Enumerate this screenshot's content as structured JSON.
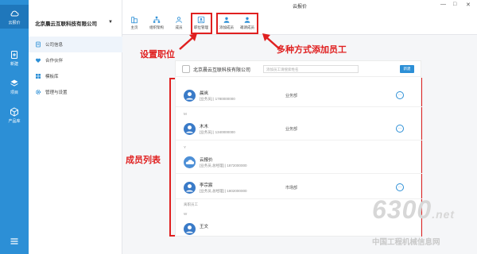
{
  "window": {
    "title": "云报价",
    "minimize": "—",
    "maximize": "□",
    "close": "✕"
  },
  "leftnav": {
    "logo_label": "云报价",
    "items": [
      {
        "label": "新建",
        "icon": "plus-doc-icon"
      },
      {
        "label": "项目",
        "icon": "layers-icon"
      },
      {
        "label": "产品库",
        "icon": "box-icon"
      }
    ],
    "menu_icon": "hamburger-icon"
  },
  "panel": {
    "company_name": "北京晨云互联科技有限公司",
    "caret": "▼",
    "menu": [
      {
        "label": "公司信息",
        "icon": "doc-icon",
        "active": true
      },
      {
        "label": "合作伙伴",
        "icon": "heart-icon",
        "active": false
      },
      {
        "label": "模板库",
        "icon": "grid-icon",
        "active": false
      },
      {
        "label": "管理与设置",
        "icon": "gear-icon",
        "active": false
      }
    ]
  },
  "toolbar": {
    "buttons": [
      {
        "label": "主页",
        "icon": "building-icon"
      },
      {
        "label": "组织架构",
        "icon": "org-icon"
      },
      {
        "label": "成员",
        "icon": "person-icon"
      },
      {
        "label": "职位管理",
        "icon": "position-icon"
      },
      {
        "label": "添加成员",
        "icon": "add-person-icon"
      },
      {
        "label": "邀请成员",
        "icon": "invite-person-icon"
      }
    ]
  },
  "annotations": {
    "set_position": "设置职位",
    "add_staff": "多种方式添加员工",
    "member_list": "成员列表"
  },
  "content": {
    "company_name": "北京晨云互联科技有限公司",
    "search_placeholder": "添加员工请搜索姓名",
    "header_button": "新建",
    "groups": [
      "M",
      "Y",
      "离职员工",
      "W"
    ],
    "members": [
      {
        "name": "晨岚",
        "role": "[业务员] | 1780000000",
        "dept": "业务部",
        "more": "···"
      },
      {
        "name": "木木",
        "role": "[业务员] | 1340000000",
        "dept": "业务部",
        "more": "···"
      },
      {
        "name": "云报价",
        "role": "[业务员,总经理] | 1872000000",
        "dept": "",
        "more": ""
      },
      {
        "name": "李宗宸",
        "role": "[业务员,总经理] | 1802000000",
        "dept": "市场部",
        "more": "···"
      },
      {
        "name": "王文",
        "role": "",
        "dept": "",
        "more": ""
      }
    ]
  },
  "watermark": {
    "number": "6300",
    "suffix": ".net",
    "text": "中国工程机械信息网"
  },
  "colors": {
    "accent": "#2c8fd6",
    "annotation": "#e02020"
  }
}
